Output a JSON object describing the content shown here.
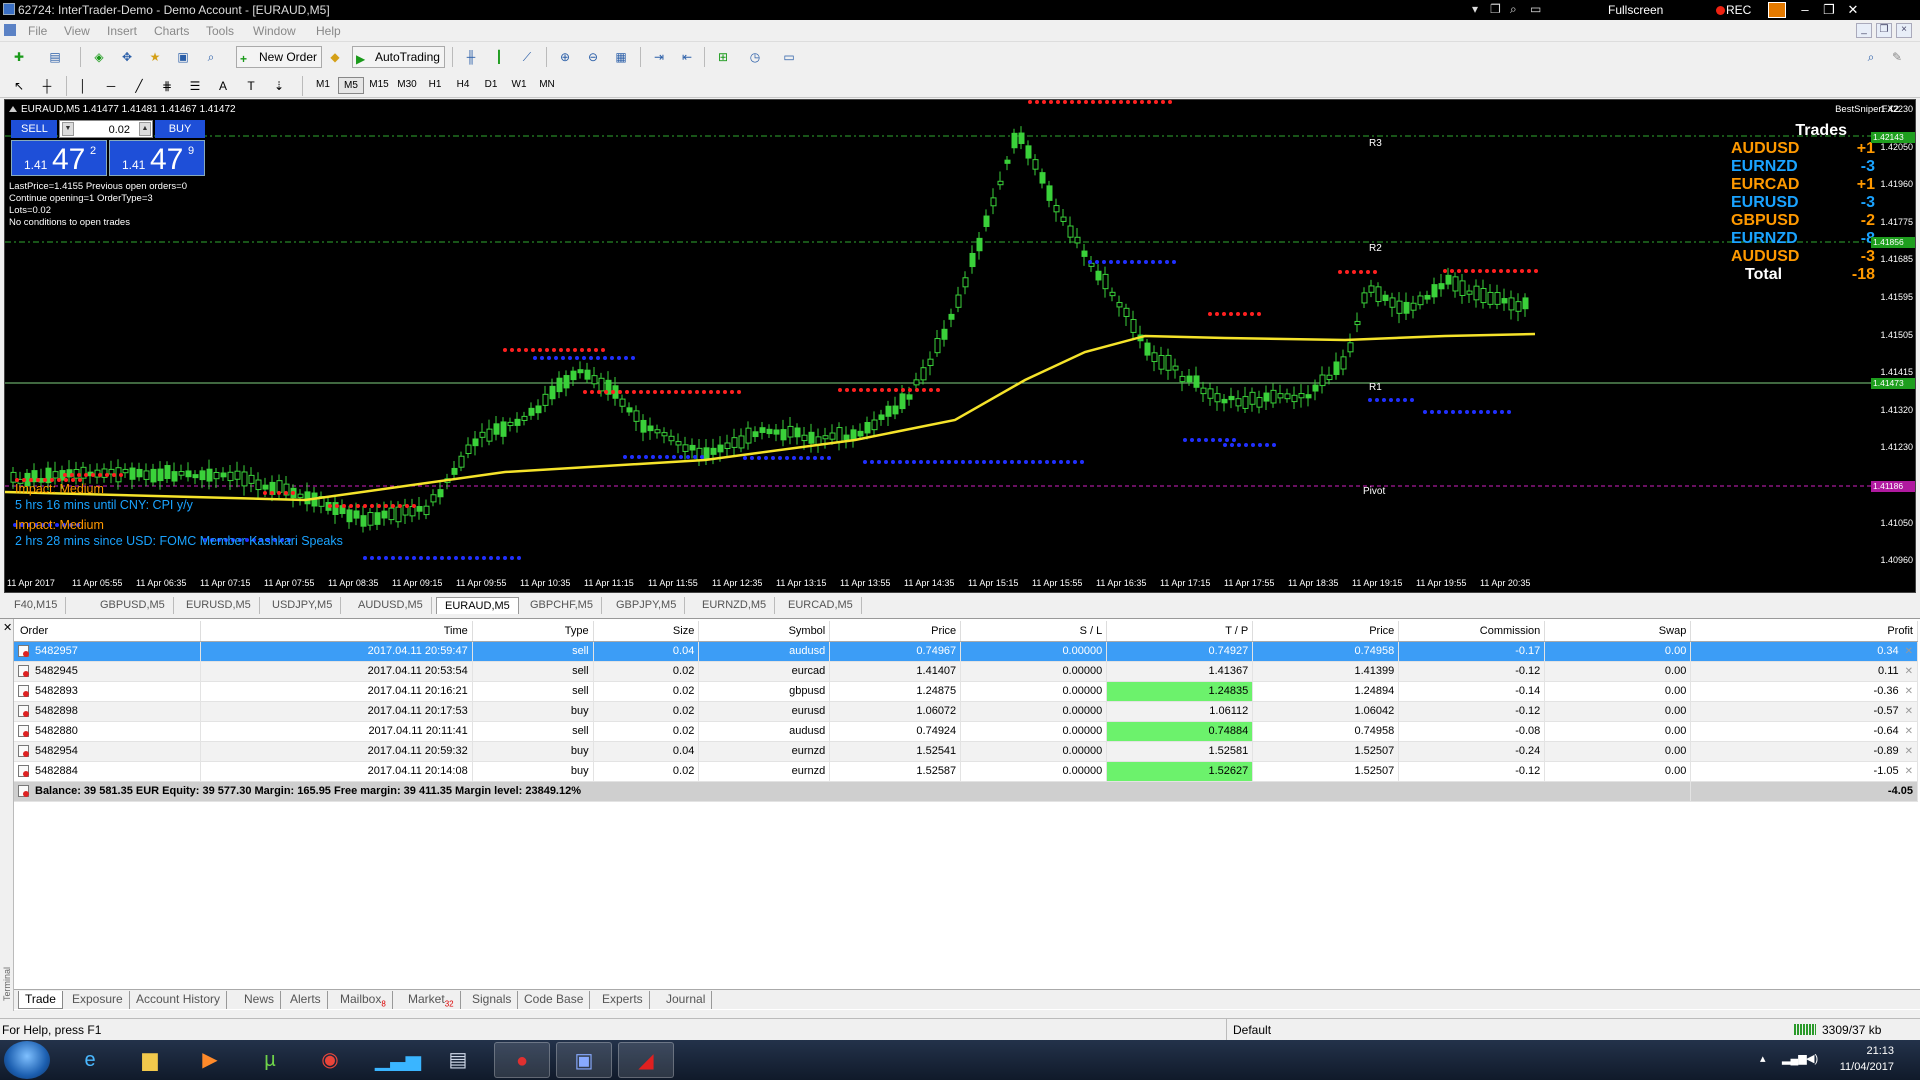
{
  "window": {
    "title": "62724: InterTrader-Demo - Demo Account - [EURAUD,M5]",
    "fullscreen_label": "Fullscreen",
    "rec_label": "REC"
  },
  "menu": [
    "File",
    "View",
    "Insert",
    "Charts",
    "Tools",
    "Window",
    "Help"
  ],
  "toolbar": {
    "new_order": "New Order",
    "autotrading": "AutoTrading",
    "timeframes": [
      "M1",
      "M5",
      "M15",
      "M30",
      "H1",
      "H4",
      "D1",
      "W1",
      "MN"
    ]
  },
  "chart": {
    "symbol_line": "EURAUD,M5  1.41477 1.41481 1.41467 1.41472",
    "indicator_name": "BestSniperFX2",
    "oneclick": {
      "sell_label": "SELL",
      "buy_label": "BUY",
      "lot": "0.02",
      "sell_small": "1.41",
      "sell_big": "47",
      "sell_sup": "2",
      "buy_small": "1.41",
      "buy_big": "47",
      "buy_sup": "9"
    },
    "ea_info": [
      "LastPrice=1.4155 Previous open orders=0",
      "Continue opening=1 OrderType=3",
      "Lots=0.02",
      "No conditions to open trades"
    ],
    "trades": {
      "header": "Trades",
      "rows": [
        {
          "symbol": "AUDUSD",
          "value": "+1",
          "color": "#ff9900"
        },
        {
          "symbol": "EURNZD",
          "value": "-3",
          "color": "#1aa3ff"
        },
        {
          "symbol": "EURCAD",
          "value": "+1",
          "color": "#ff9900"
        },
        {
          "symbol": "EURUSD",
          "value": "-3",
          "color": "#1aa3ff"
        },
        {
          "symbol": "GBPUSD",
          "value": "-2",
          "color": "#ff9900"
        },
        {
          "symbol": "EURNZD",
          "value": "-8",
          "color": "#1aa3ff"
        },
        {
          "symbol": "AUDUSD",
          "value": "-3",
          "color": "#ff9900"
        }
      ],
      "total_label": "Total",
      "total_value": "-18"
    },
    "levels": {
      "r3": "R3",
      "r2": "R2",
      "r1": "R1",
      "pivot": "Pivot"
    },
    "news": [
      {
        "text": "Impact: Medium",
        "color": "#ff9900"
      },
      {
        "text": "5 hrs 16 mins until CNY: CPI y/y",
        "color": "#1aa3ff"
      },
      {
        "text": "Impact: Medium",
        "color": "#ff9900"
      },
      {
        "text": "2 hrs 28 mins since USD: FOMC Member Kashkari Speaks",
        "color": "#1aa3ff"
      }
    ],
    "price_axis": [
      "1.42230",
      "1.42050",
      "1.41960",
      "1.41775",
      "1.41685",
      "1.41595",
      "1.41505",
      "1.41415",
      "1.41320",
      "1.41230",
      "1.41140",
      "1.41050",
      "1.40960"
    ],
    "price_tags": [
      {
        "text": "1.42143",
        "bg": "#1e9e1e"
      },
      {
        "text": "1.41856",
        "bg": "#1e9e1e"
      },
      {
        "text": "1.41473",
        "bg": "#1e9e1e"
      },
      {
        "text": "1.41186",
        "bg": "#b0199f"
      }
    ],
    "time_axis": [
      "11 Apr 2017",
      "11 Apr 05:55",
      "11 Apr 06:35",
      "11 Apr 07:15",
      "11 Apr 07:55",
      "11 Apr 08:35",
      "11 Apr 09:15",
      "11 Apr 09:55",
      "11 Apr 10:35",
      "11 Apr 11:15",
      "11 Apr 11:55",
      "11 Apr 12:35",
      "11 Apr 13:15",
      "11 Apr 13:55",
      "11 Apr 14:35",
      "11 Apr 15:15",
      "11 Apr 15:55",
      "11 Apr 16:35",
      "11 Apr 17:15",
      "11 Apr 17:55",
      "11 Apr 18:35",
      "11 Apr 19:15",
      "11 Apr 19:55",
      "11 Apr 20:35"
    ]
  },
  "chart_tabs": [
    "F40,M15",
    "GBPUSD,M5",
    "EURUSD,M5",
    "USDJPY,M5",
    "AUDUSD,M5",
    "EURAUD,M5",
    "GBPCHF,M5",
    "GBPJPY,M5",
    "EURNZD,M5",
    "EURCAD,M5"
  ],
  "terminal": {
    "side_label": "Terminal",
    "columns": [
      "Order",
      "Time",
      "Type",
      "Size",
      "Symbol",
      "Price",
      "S / L",
      "T / P",
      "Price",
      "Commission",
      "Swap",
      "Profit"
    ],
    "rows": [
      [
        "5482957",
        "2017.04.11 20:59:47",
        "sell",
        "0.04",
        "audusd",
        "0.74967",
        "0.00000",
        "0.74927",
        "0.74958",
        "-0.17",
        "0.00",
        "0.34"
      ],
      [
        "5482945",
        "2017.04.11 20:53:54",
        "sell",
        "0.02",
        "eurcad",
        "1.41407",
        "0.00000",
        "1.41367",
        "1.41399",
        "-0.12",
        "0.00",
        "0.11"
      ],
      [
        "5482893",
        "2017.04.11 20:16:21",
        "sell",
        "0.02",
        "gbpusd",
        "1.24875",
        "0.00000",
        "1.24835",
        "1.24894",
        "-0.14",
        "0.00",
        "-0.36"
      ],
      [
        "5482898",
        "2017.04.11 20:17:53",
        "buy",
        "0.02",
        "eurusd",
        "1.06072",
        "0.00000",
        "1.06112",
        "1.06042",
        "-0.12",
        "0.00",
        "-0.57"
      ],
      [
        "5482880",
        "2017.04.11 20:11:41",
        "sell",
        "0.02",
        "audusd",
        "0.74924",
        "0.00000",
        "0.74884",
        "0.74958",
        "-0.08",
        "0.00",
        "-0.64"
      ],
      [
        "5482954",
        "2017.04.11 20:59:32",
        "buy",
        "0.04",
        "eurnzd",
        "1.52541",
        "0.00000",
        "1.52581",
        "1.52507",
        "-0.24",
        "0.00",
        "-0.89"
      ],
      [
        "5482884",
        "2017.04.11 20:14:08",
        "buy",
        "0.02",
        "eurnzd",
        "1.52587",
        "0.00000",
        "1.52627",
        "1.52507",
        "-0.12",
        "0.00",
        "-1.05"
      ]
    ],
    "balance_line": "Balance: 39 581.35 EUR  Equity: 39 577.30  Margin: 165.95  Free margin: 39 411.35  Margin level: 23849.12%",
    "balance_profit": "-4.05",
    "tabs": [
      {
        "label": "Trade",
        "badge": ""
      },
      {
        "label": "Exposure",
        "badge": ""
      },
      {
        "label": "Account History",
        "badge": ""
      },
      {
        "label": "News",
        "badge": ""
      },
      {
        "label": "Alerts",
        "badge": ""
      },
      {
        "label": "Mailbox",
        "badge": "8"
      },
      {
        "label": "Market",
        "badge": "32"
      },
      {
        "label": "Signals",
        "badge": ""
      },
      {
        "label": "Code Base",
        "badge": ""
      },
      {
        "label": "Experts",
        "badge": ""
      },
      {
        "label": "Journal",
        "badge": ""
      }
    ]
  },
  "status": {
    "help": "For Help, press F1",
    "profile": "Default",
    "traffic": "3309/37 kb"
  },
  "taskbar": {
    "apps": [
      "ie-icon",
      "folder-icon",
      "media-player-icon",
      "utorrent-icon",
      "chrome-icon",
      "chart-app-icon",
      "window-app-icon",
      "recorder-icon",
      "network-app-icon",
      "pdf-icon"
    ],
    "time": "21:13",
    "date": "11/04/2017"
  }
}
